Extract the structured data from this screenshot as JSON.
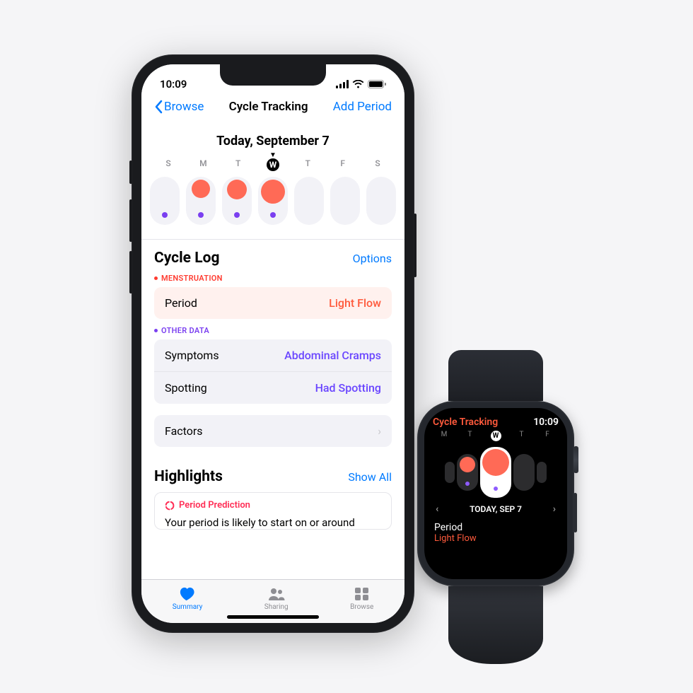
{
  "phone": {
    "status": {
      "time": "10:09"
    },
    "nav": {
      "back": "Browse",
      "title": "Cycle Tracking",
      "action": "Add Period"
    },
    "today_label": "Today, September 7",
    "day_letters": [
      "S",
      "M",
      "T",
      "W",
      "T",
      "F",
      "S"
    ],
    "today_index": 3,
    "pills": [
      {
        "red": 0,
        "purple": true
      },
      {
        "red": 26,
        "purple": true
      },
      {
        "red": 28,
        "purple": true
      },
      {
        "red": 34,
        "purple": true
      },
      {
        "red": 0,
        "purple": false
      },
      {
        "red": 0,
        "purple": false
      },
      {
        "red": 0,
        "purple": false
      }
    ],
    "cycle_log": {
      "title": "Cycle Log",
      "options": "Options",
      "menstruation_label": "MENSTRUATION",
      "period_row": {
        "label": "Period",
        "value": "Light Flow"
      },
      "other_label": "OTHER DATA",
      "symptoms_row": {
        "label": "Symptoms",
        "value": "Abdominal Cramps"
      },
      "spotting_row": {
        "label": "Spotting",
        "value": "Had Spotting"
      },
      "factors_label": "Factors"
    },
    "highlights": {
      "title": "Highlights",
      "show_all": "Show All",
      "card_title": "Period Prediction",
      "card_body": "Your period is likely to start on or around"
    },
    "tabs": {
      "summary": "Summary",
      "sharing": "Sharing",
      "browse": "Browse"
    }
  },
  "watch": {
    "title": "Cycle Tracking",
    "time": "10:09",
    "day_letters": [
      "M",
      "T",
      "W",
      "T",
      "F"
    ],
    "today_index": 2,
    "date_label": "TODAY, SEP 7",
    "period": {
      "label": "Period",
      "value": "Light Flow"
    }
  }
}
